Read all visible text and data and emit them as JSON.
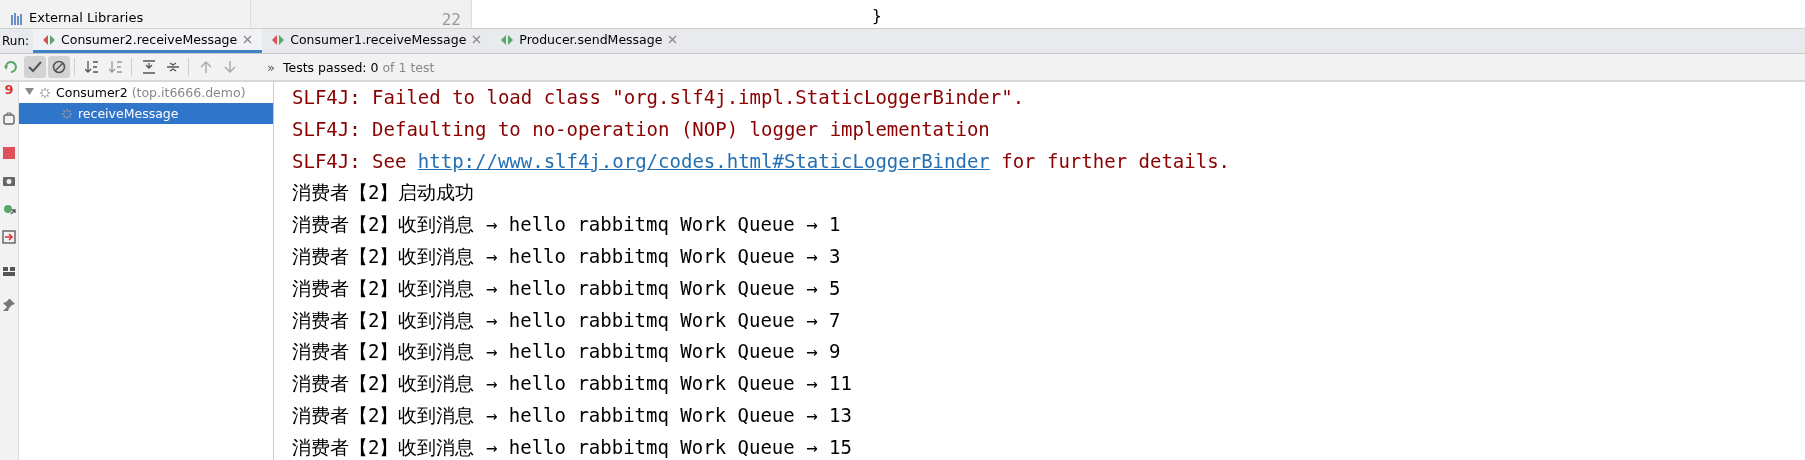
{
  "project_tree": {
    "items": [
      "External Libraries"
    ]
  },
  "editor": {
    "line_number": "22",
    "code": "}"
  },
  "run_panel": {
    "label": "Run:",
    "tabs": [
      {
        "label": "Consumer2.receiveMessage",
        "selected": true,
        "color": "#d9534f"
      },
      {
        "label": "Consumer1.receiveMessage",
        "selected": false,
        "color": "#d9534f"
      },
      {
        "label": "Producer.sendMessage",
        "selected": false,
        "color": "#59a869"
      }
    ],
    "toolbar": {
      "show_passed": {
        "on": true
      },
      "show_ignored": {
        "on": true
      },
      "more": "»",
      "status": "Tests passed: 0",
      "status_rest": "of 1 test"
    },
    "side_badge": "9",
    "tree": [
      {
        "name": "Consumer2",
        "detail": "(top.it6666.demo)",
        "expanded": true,
        "selected": false,
        "children": [
          {
            "name": "receiveMessage",
            "selected": true
          }
        ]
      }
    ],
    "console": [
      {
        "kind": "error",
        "text": "SLF4J: Failed to load class \"org.slf4j.impl.StaticLoggerBinder\"."
      },
      {
        "kind": "error",
        "text": "SLF4J: Defaulting to no-operation (NOP) logger implementation"
      },
      {
        "kind": "error",
        "text": "SLF4J: See ",
        "link": "http://www.slf4j.org/codes.html#StaticLoggerBinder",
        "after": " for further details."
      },
      {
        "kind": "output",
        "text": "消费者【2】启动成功"
      },
      {
        "kind": "output",
        "text": "消费者【2】收到消息 → hello rabbitmq Work Queue → 1"
      },
      {
        "kind": "output",
        "text": "消费者【2】收到消息 → hello rabbitmq Work Queue → 3"
      },
      {
        "kind": "output",
        "text": "消费者【2】收到消息 → hello rabbitmq Work Queue → 5"
      },
      {
        "kind": "output",
        "text": "消费者【2】收到消息 → hello rabbitmq Work Queue → 7"
      },
      {
        "kind": "output",
        "text": "消费者【2】收到消息 → hello rabbitmq Work Queue → 9"
      },
      {
        "kind": "output",
        "text": "消费者【2】收到消息 → hello rabbitmq Work Queue → 11"
      },
      {
        "kind": "output",
        "text": "消费者【2】收到消息 → hello rabbitmq Work Queue → 13"
      },
      {
        "kind": "output",
        "text": "消费者【2】收到消息 → hello rabbitmq Work Queue → 15"
      }
    ]
  }
}
